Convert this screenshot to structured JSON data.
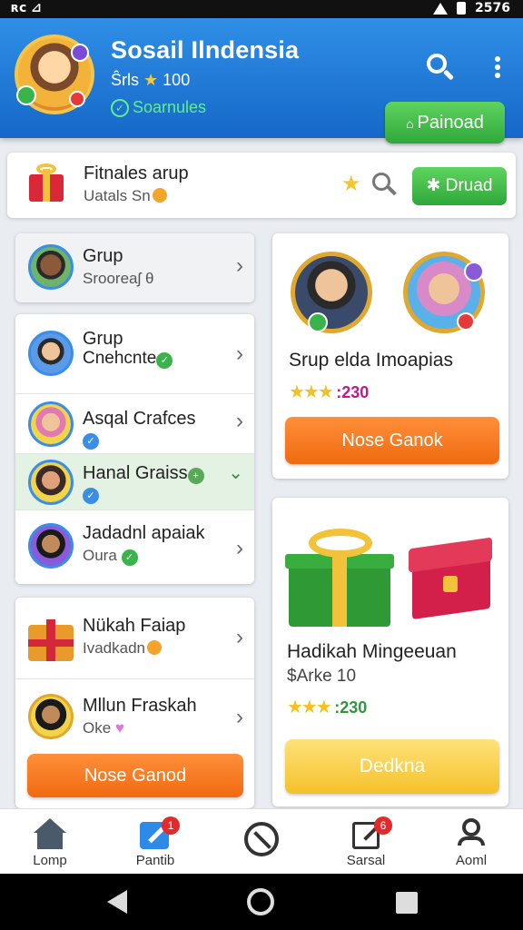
{
  "status_bar": {
    "left": "ʀc ⊿",
    "right": "2576"
  },
  "header": {
    "title": "Sosail Ilndensia",
    "subline_prefix": "Ŝrls",
    "subline_star": "★",
    "subline_count": "100",
    "status": "Soarnules",
    "button_label": "Painoad",
    "button_icon": "home-icon"
  },
  "notify": {
    "title": "Fitnales arup",
    "subtitle": "Uatals Sn",
    "button_label": "Druad"
  },
  "group_header": {
    "title": "Grup",
    "subtitle": "Srooreaʃ θ"
  },
  "groups": [
    {
      "title": "Grup",
      "subtitle": "Cnehcnte",
      "badge": "✓",
      "badge_color": "#3ab34a"
    },
    {
      "title": "Asqal Crafces",
      "subtitle": "",
      "badge": "✓",
      "badge_color": "#3a8ee8"
    },
    {
      "title": "Hanal Graiss",
      "subtitle": "",
      "badge": "✓",
      "badge_color": "#3a8ee8"
    },
    {
      "title": "Jadadnl apaiak",
      "subtitle": "Oura",
      "badge": "✓",
      "badge_color": "#3ab34a"
    }
  ],
  "gift_list": [
    {
      "title": "Nükah Faiap",
      "subtitle": "Ivadkadn"
    },
    {
      "title": "Mllun Fraskah",
      "subtitle": "Oke"
    }
  ],
  "left_button": "Nose Ganod",
  "feature_card": {
    "title": "Srup elda Imoapias",
    "stars": "★★★",
    "count": "230",
    "button": "Nose Ganok"
  },
  "gift_card": {
    "title": "Hadikah Mingeeuan",
    "price": "$Arke 10",
    "stars": "★★★",
    "count": "230",
    "button": "Dedkna"
  },
  "bottom_nav": [
    {
      "label": "Lomp",
      "icon": "home-icon"
    },
    {
      "label": "Pantib",
      "icon": "edit-icon",
      "badge": "1"
    },
    {
      "label": "",
      "icon": "compass-icon"
    },
    {
      "label": "Sarsal",
      "icon": "compose-icon",
      "badge": "6"
    },
    {
      "label": "Aoml",
      "icon": "user-icon"
    }
  ],
  "colors": {
    "header": "#1f7ad8",
    "accent_green": "#2fa83a",
    "accent_orange": "#f06a10",
    "accent_yellow": "#f4c12a"
  }
}
